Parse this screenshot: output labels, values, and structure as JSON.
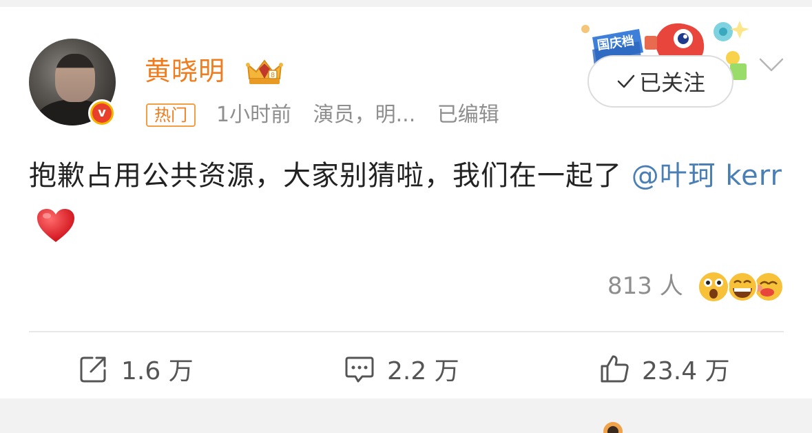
{
  "post": {
    "author": "黄晓明",
    "hot_tag": "热门",
    "time": "1小时前",
    "role": "演员，明...",
    "edited": "已编辑",
    "follow_label": "已关注",
    "content_text": "抱歉占用公共资源，大家别猜啦，我们在一起了",
    "mention": "@叶珂 kerr",
    "banner_text": "国庆档",
    "reactions_count": "813 人",
    "actions": {
      "repost": "1.6 万",
      "comment": "2.2 万",
      "like": "23.4 万"
    }
  },
  "colors": {
    "username": "#f07c1e",
    "mention": "#4a7fb5",
    "meta": "#8e8e8e"
  }
}
